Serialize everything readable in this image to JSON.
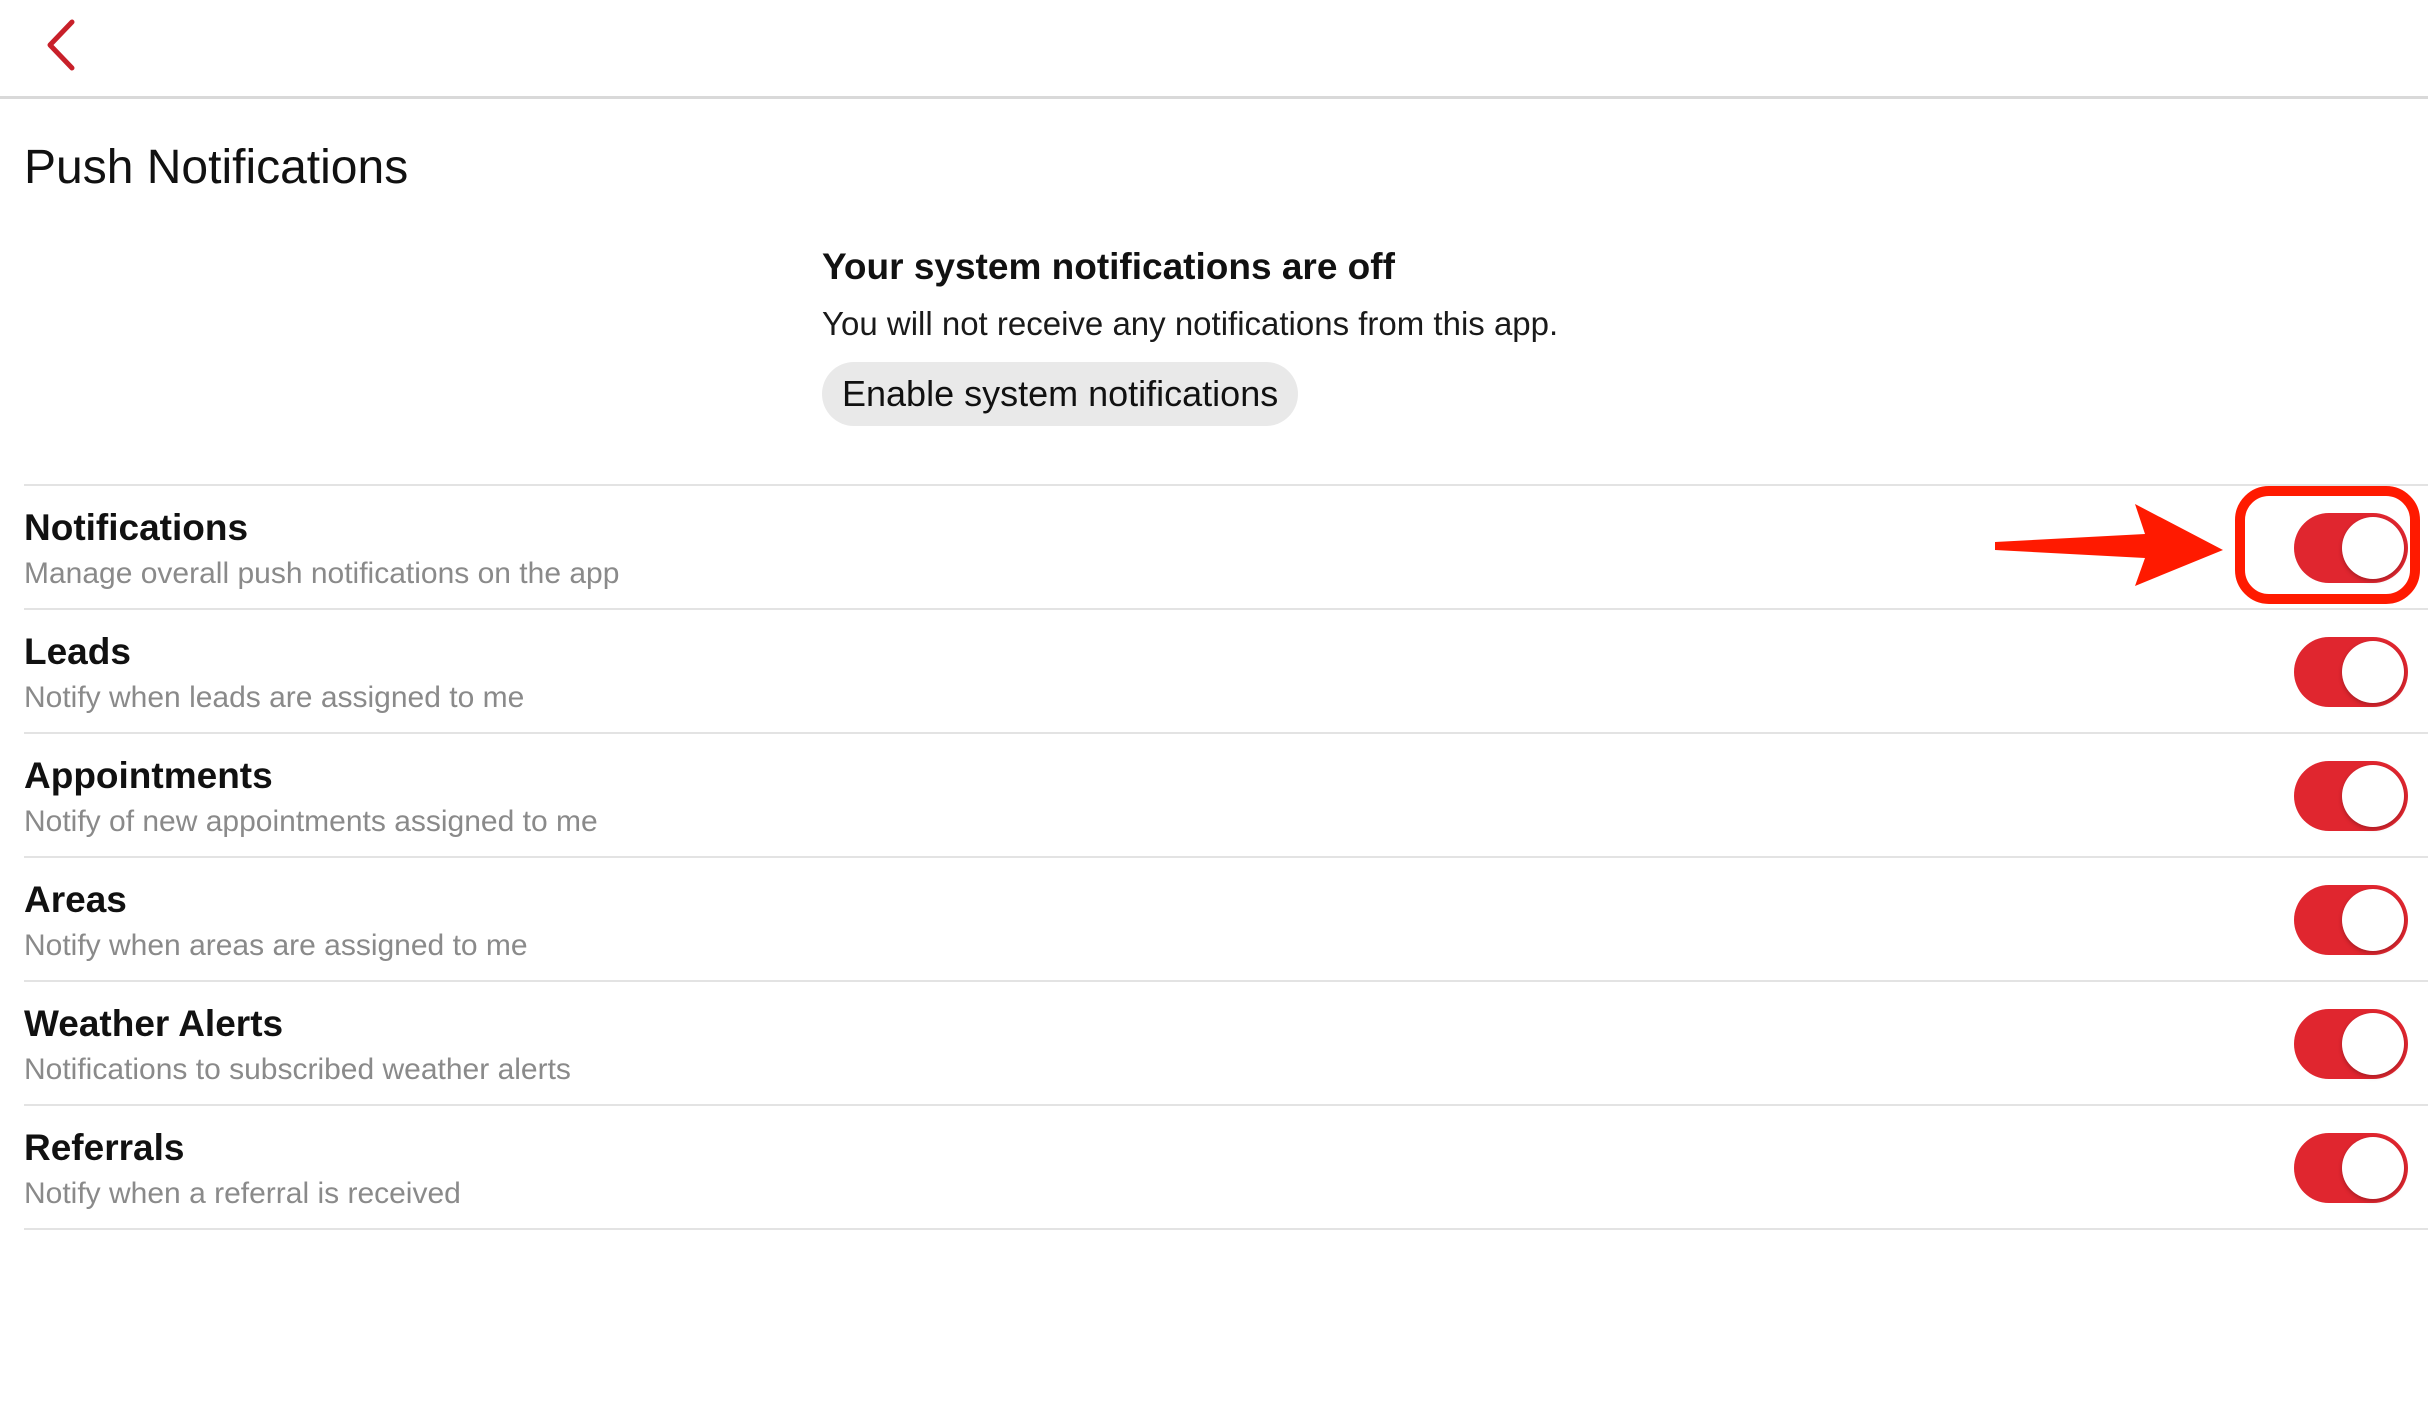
{
  "nav": {
    "back_icon": "chevron-left-icon",
    "accent_color": "#c8202a"
  },
  "page": {
    "title": "Push Notifications"
  },
  "banner": {
    "title": "Your system notifications are off",
    "text": "You will not receive any notifications from this app.",
    "button_label": "Enable system notifications"
  },
  "settings": [
    {
      "title": "Notifications",
      "subtitle": "Manage overall push notifications on the app",
      "enabled": true
    },
    {
      "title": "Leads",
      "subtitle": "Notify when leads are assigned to me",
      "enabled": true
    },
    {
      "title": "Appointments",
      "subtitle": "Notify of new appointments assigned to me",
      "enabled": true
    },
    {
      "title": "Areas",
      "subtitle": "Notify when areas are assigned to me",
      "enabled": true
    },
    {
      "title": "Weather Alerts",
      "subtitle": "Notifications to subscribed weather alerts",
      "enabled": true
    },
    {
      "title": "Referrals",
      "subtitle": "Notify when a referral is received",
      "enabled": true
    }
  ],
  "annotation": {
    "color": "#ff1a00",
    "target": "Notifications"
  },
  "colors": {
    "toggle_on": "#e0262f",
    "divider": "#e3e3e3",
    "subtitle": "#8a8a8a"
  }
}
